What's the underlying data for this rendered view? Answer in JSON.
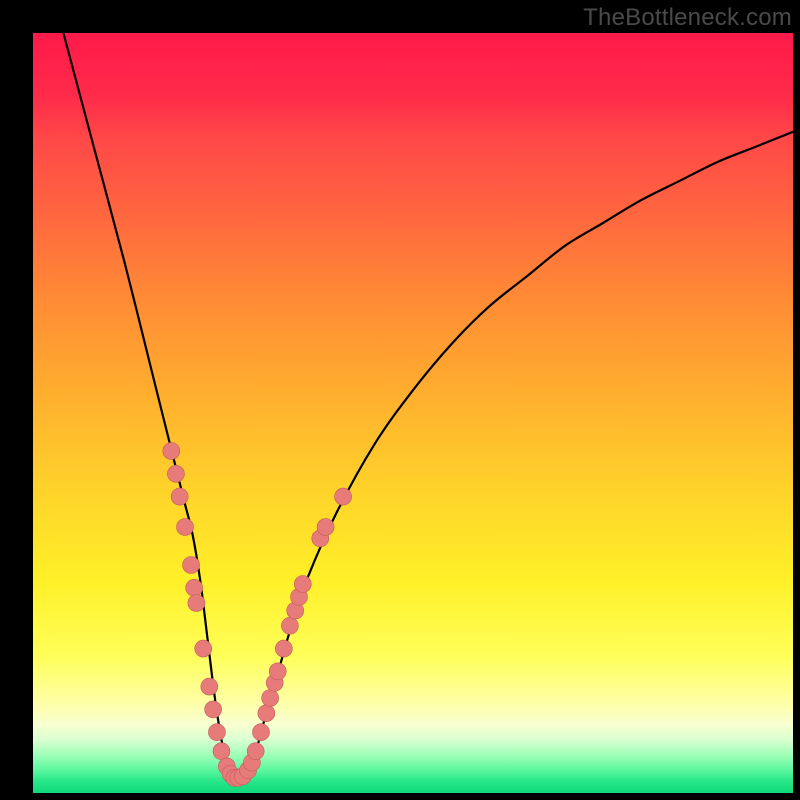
{
  "watermark": "TheBottleneck.com",
  "colors": {
    "frame": "#000000",
    "curve": "#000000",
    "markers_fill": "#e77b7a",
    "markers_stroke": "#c25c5b"
  },
  "chart_data": {
    "type": "line",
    "title": "",
    "xlabel": "",
    "ylabel": "",
    "xlim": [
      0,
      100
    ],
    "ylim": [
      0,
      100
    ],
    "grid": false,
    "legend": false,
    "series": [
      {
        "name": "curve",
        "x": [
          4,
          8,
          12,
          16,
          18,
          19,
          20,
          21,
          22,
          23,
          24,
          25,
          26,
          27,
          28,
          29,
          30,
          32,
          34,
          36,
          40,
          45,
          50,
          55,
          60,
          65,
          70,
          75,
          80,
          85,
          90,
          95,
          100
        ],
        "y": [
          100,
          85,
          70,
          54,
          46,
          42,
          38,
          34,
          28,
          20,
          12,
          6,
          3,
          2,
          2,
          4,
          8,
          15,
          22,
          28,
          37,
          46,
          53,
          59,
          64,
          68,
          72,
          75,
          78,
          80.5,
          83,
          85,
          87
        ]
      }
    ],
    "markers": [
      {
        "x": 18.2,
        "y": 45
      },
      {
        "x": 18.8,
        "y": 42
      },
      {
        "x": 19.3,
        "y": 39
      },
      {
        "x": 20.0,
        "y": 35
      },
      {
        "x": 20.8,
        "y": 30
      },
      {
        "x": 21.2,
        "y": 27
      },
      {
        "x": 21.5,
        "y": 25
      },
      {
        "x": 22.4,
        "y": 19
      },
      {
        "x": 23.2,
        "y": 14
      },
      {
        "x": 23.7,
        "y": 11
      },
      {
        "x": 24.2,
        "y": 8
      },
      {
        "x": 24.8,
        "y": 5.5
      },
      {
        "x": 25.5,
        "y": 3.5
      },
      {
        "x": 26.0,
        "y": 2.5
      },
      {
        "x": 26.5,
        "y": 2
      },
      {
        "x": 27.0,
        "y": 2
      },
      {
        "x": 27.6,
        "y": 2.2
      },
      {
        "x": 28.3,
        "y": 3
      },
      {
        "x": 28.8,
        "y": 4
      },
      {
        "x": 29.3,
        "y": 5.5
      },
      {
        "x": 30.0,
        "y": 8
      },
      {
        "x": 30.7,
        "y": 10.5
      },
      {
        "x": 31.2,
        "y": 12.5
      },
      {
        "x": 31.8,
        "y": 14.5
      },
      {
        "x": 32.2,
        "y": 16
      },
      {
        "x": 33.0,
        "y": 19
      },
      {
        "x": 33.8,
        "y": 22
      },
      {
        "x": 34.5,
        "y": 24
      },
      {
        "x": 35.0,
        "y": 25.8
      },
      {
        "x": 35.5,
        "y": 27.5
      },
      {
        "x": 37.8,
        "y": 33.5
      },
      {
        "x": 38.5,
        "y": 35
      },
      {
        "x": 40.8,
        "y": 39
      }
    ]
  }
}
